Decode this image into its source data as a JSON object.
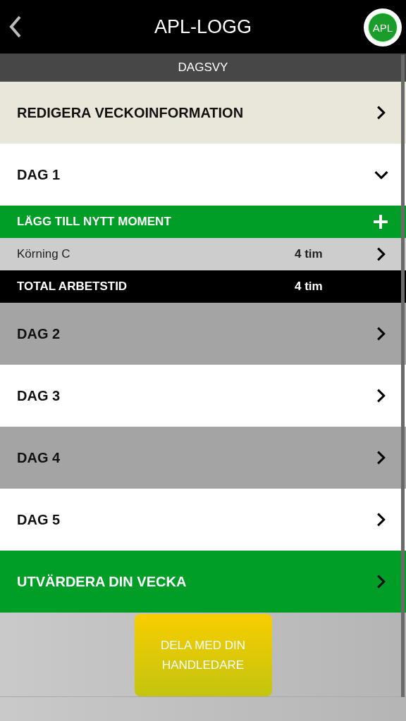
{
  "header": {
    "title": "APL-LOGG",
    "logo_text": "APL"
  },
  "subheader": {
    "title": "DAGSVY"
  },
  "week_info": {
    "label": "REDIGERA VECKOINFORMATION"
  },
  "days": [
    {
      "label": "DAG 1",
      "expanded": true,
      "add_label": "LÄGG TILL NYTT MOMENT",
      "entries": [
        {
          "name": "Körning C",
          "hours": "4 tim"
        }
      ],
      "total": {
        "label": "TOTAL ARBETSTID",
        "hours": "4 tim"
      }
    },
    {
      "label": "DAG 2",
      "expanded": false
    },
    {
      "label": "DAG 3",
      "expanded": false
    },
    {
      "label": "DAG 4",
      "expanded": false
    },
    {
      "label": "DAG 5",
      "expanded": false
    }
  ],
  "evaluate": {
    "label": "UTVÄRDERA DIN VECKA"
  },
  "share_button": {
    "label": "DELA MED DIN HANDLEDARE"
  }
}
